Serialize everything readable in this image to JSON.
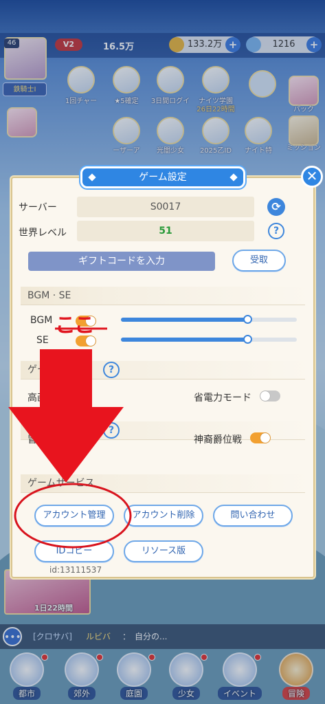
{
  "hud": {
    "level": "46",
    "rank_title": "鉄騎士I",
    "vip": "V2",
    "power": "16.5万",
    "gold": "133.2万",
    "gems": "1216"
  },
  "events": [
    {
      "label": "1回チャー"
    },
    {
      "label": "★5確定"
    },
    {
      "label": "3日間ログイ"
    },
    {
      "label": "ナイツ学園",
      "sub": "26日22時間"
    },
    {
      "label": "ーザーア"
    },
    {
      "label": "光闇少女"
    },
    {
      "label": "2025乙ID"
    },
    {
      "label": "ナイト特"
    }
  ],
  "side_buttons": [
    {
      "label": "パック"
    },
    {
      "label": "ミッション"
    }
  ],
  "banner": {
    "timer": "1日22時間"
  },
  "dialog": {
    "title": "ゲーム設定",
    "close": "✕",
    "server_label": "サーバー",
    "server_value": "S0017",
    "world_level_label": "世界レベル",
    "world_level_value": "51",
    "gift_code_button": "ギフトコードを入力",
    "receive_button": "受取",
    "section_bgm_se": "BGM · SE",
    "bgm_label": "BGM",
    "se_label": "SE",
    "bgm_volume": 0.72,
    "se_volume": 0.72,
    "bgm_on": true,
    "se_on": true,
    "section_graphics": "ゲーム",
    "hq_label": "高画質",
    "power_save_label": "省電力モード",
    "power_save_on": false,
    "section_notice": "ゲー",
    "adv_report_label": "冒険報告",
    "noble_battle_label": "神裔爵位戦",
    "noble_battle_on": true,
    "section_service": "ゲームサービス",
    "account_manage": "アカウント管理",
    "account_delete": "アカウント削除",
    "contact": "問い合わせ",
    "id_copy": "IDコピー",
    "resource_version": "リソース版",
    "user_id": "id:13111537"
  },
  "annotation": {
    "here_text": "ここ"
  },
  "chat": {
    "channel": "[クロサバ]",
    "name": "ルビバ",
    "message": "：　自分の..."
  },
  "nav": [
    {
      "label": "都市"
    },
    {
      "label": "郊外"
    },
    {
      "label": "庭園"
    },
    {
      "label": "少女"
    },
    {
      "label": "イベント"
    },
    {
      "label": "冒険"
    }
  ],
  "colors": {
    "accent": "#2f86e3",
    "toggle_on": "#f2a030",
    "annotation_red": "#e0141e"
  }
}
